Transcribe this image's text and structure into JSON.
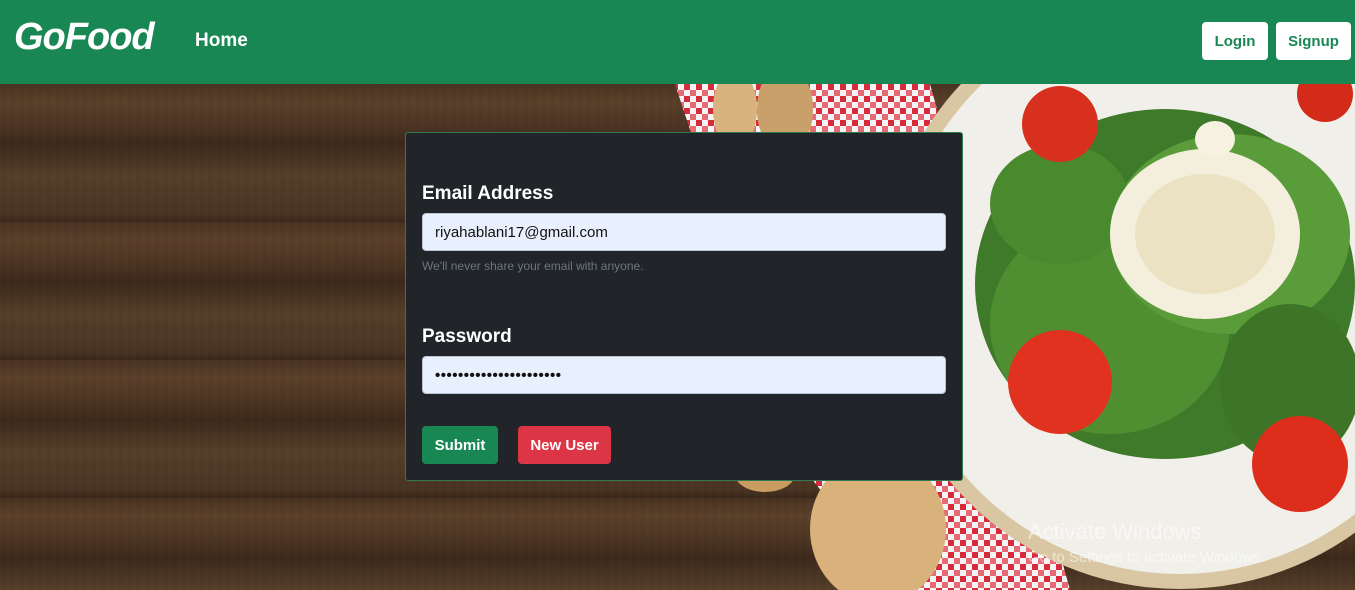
{
  "navbar": {
    "brand": "GoFood",
    "home_label": "Home",
    "login_label": "Login",
    "signup_label": "Signup"
  },
  "form": {
    "email_label": "Email Address",
    "email_value": "riyahablani17@gmail.com",
    "email_help": "We'll never share your email with anyone.",
    "password_label": "Password",
    "password_masked": "••••••••••••••••••••••",
    "submit_label": "Submit",
    "new_user_label": "New User"
  },
  "watermark": {
    "line1": "Activate Windows",
    "line2": "Go to Settings to activate Windows."
  },
  "colors": {
    "navbar": "#198754",
    "card": "#212529",
    "danger": "#dc3545",
    "input_bg": "#e8f0fe"
  }
}
